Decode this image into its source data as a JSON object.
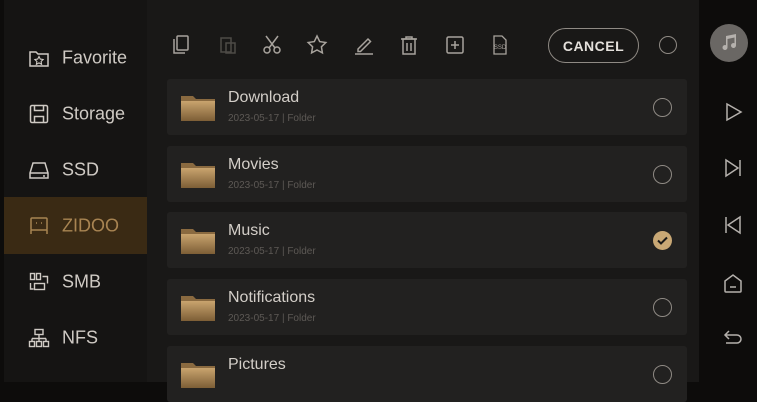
{
  "sidebar": {
    "items": [
      {
        "label": "Favorite",
        "icon": "favorite-folder-icon"
      },
      {
        "label": "Storage",
        "icon": "storage-save-icon"
      },
      {
        "label": "SSD",
        "icon": "ssd-drive-icon"
      },
      {
        "label": "ZIDOO",
        "icon": "zidoo-device-icon",
        "active": true
      },
      {
        "label": "SMB",
        "icon": "smb-network-icon"
      },
      {
        "label": "NFS",
        "icon": "nfs-network-icon"
      }
    ]
  },
  "toolbar": {
    "icons": [
      "copy-icon",
      "paste-icon",
      "cut-icon",
      "star-icon",
      "rename-icon",
      "delete-icon",
      "new-folder-icon",
      "ssd-transfer-icon"
    ],
    "cancel_label": "CANCEL",
    "ssd_badge": "SSD"
  },
  "files": [
    {
      "name": "Download",
      "date": "2023-05-17",
      "type": "Folder",
      "selected": false
    },
    {
      "name": "Movies",
      "date": "2023-05-17",
      "type": "Folder",
      "selected": false
    },
    {
      "name": "Music",
      "date": "2023-05-17",
      "type": "Folder",
      "selected": true
    },
    {
      "name": "Notifications",
      "date": "2023-05-17",
      "type": "Folder",
      "selected": false
    },
    {
      "name": "Pictures",
      "date": "",
      "type": "",
      "selected": false
    }
  ],
  "meta_separator": "|",
  "right_panel": {
    "icons": [
      "music-note-icon",
      "play-icon",
      "next-track-icon",
      "previous-track-icon",
      "home-icon",
      "back-icon"
    ]
  },
  "colors": {
    "accent": "#c9a875",
    "active_bg": "#3a2a14",
    "active_text": "#a88452"
  }
}
